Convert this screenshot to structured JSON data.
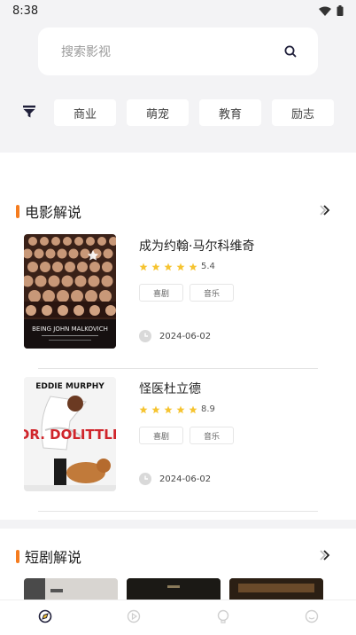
{
  "status_bar": {
    "time": "8:38"
  },
  "search": {
    "placeholder": "搜索影视"
  },
  "filters": [
    "商业",
    "萌宠",
    "教育",
    "励志"
  ],
  "section_movies": {
    "title": "电影解说",
    "items": [
      {
        "title": "成为约翰·马尔科维奇",
        "rating": "5.4",
        "tags": [
          "喜剧",
          "音乐"
        ],
        "date": "2024-06-02",
        "poster_caption": "BEING JOHN MALKOVICH"
      },
      {
        "title": "怪医杜立德",
        "rating": "8.9",
        "tags": [
          "喜剧",
          "音乐"
        ],
        "date": "2024-06-02",
        "poster_caption_top": "EDDIE MURPHY",
        "poster_caption_main": "DR. DOLITTLE"
      }
    ]
  },
  "section_short": {
    "title": "短剧解说"
  },
  "colors": {
    "accent": "#f57c1f",
    "star": "#f6c431",
    "background": "#f3f3f5"
  },
  "tabbar": [
    "home-icon",
    "play-icon",
    "bulb-icon",
    "profile-icon"
  ]
}
